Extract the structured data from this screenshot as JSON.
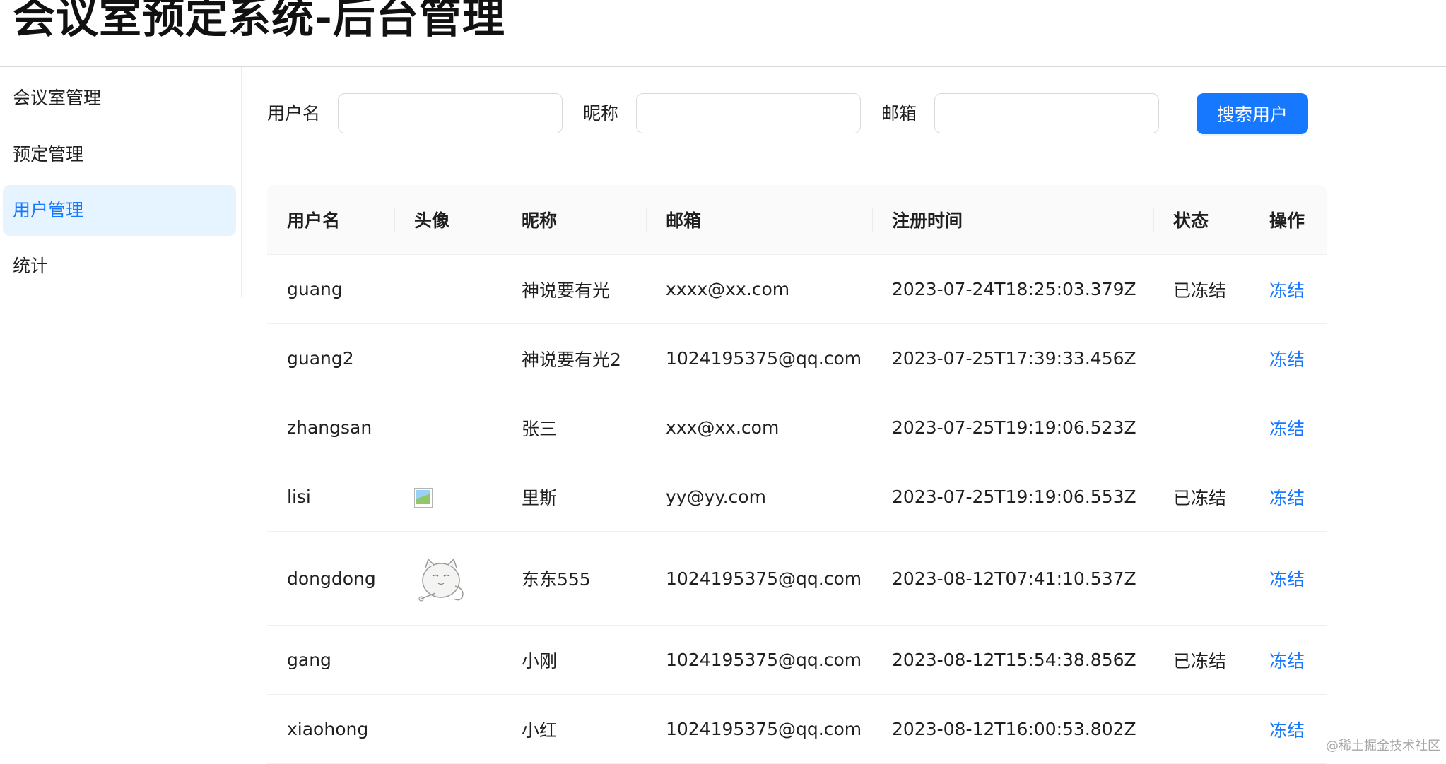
{
  "header": {
    "title": "会议室预定系统-后台管理"
  },
  "sidebar": {
    "items": [
      {
        "label": "会议室管理",
        "active": false
      },
      {
        "label": "预定管理",
        "active": false
      },
      {
        "label": "用户管理",
        "active": true
      },
      {
        "label": "统计",
        "active": false
      }
    ]
  },
  "search": {
    "username_label": "用户名",
    "username_value": "",
    "nickname_label": "昵称",
    "nickname_value": "",
    "email_label": "邮箱",
    "email_value": "",
    "button_label": "搜索用户"
  },
  "table": {
    "columns": [
      "用户名",
      "头像",
      "昵称",
      "邮箱",
      "注册时间",
      "状态",
      "操作"
    ],
    "rows": [
      {
        "username": "guang",
        "avatar": "none",
        "nickname": "神说要有光",
        "email": "xxxx@xx.com",
        "created": "2023-07-24T18:25:03.379Z",
        "status": "已冻结",
        "action": "冻结"
      },
      {
        "username": "guang2",
        "avatar": "none",
        "nickname": "神说要有光2",
        "email": "1024195375@qq.com",
        "created": "2023-07-25T17:39:33.456Z",
        "status": "",
        "action": "冻结"
      },
      {
        "username": "zhangsan",
        "avatar": "none",
        "nickname": "张三",
        "email": "xxx@xx.com",
        "created": "2023-07-25T19:19:06.523Z",
        "status": "",
        "action": "冻结"
      },
      {
        "username": "lisi",
        "avatar": "broken-image-icon",
        "nickname": "里斯",
        "email": "yy@yy.com",
        "created": "2023-07-25T19:19:06.553Z",
        "status": "已冻结",
        "action": "冻结"
      },
      {
        "username": "dongdong",
        "avatar": "cat-sketch-image",
        "nickname": "东东555",
        "email": "1024195375@qq.com",
        "created": "2023-08-12T07:41:10.537Z",
        "status": "",
        "action": "冻结"
      },
      {
        "username": "gang",
        "avatar": "none",
        "nickname": "小刚",
        "email": "1024195375@qq.com",
        "created": "2023-08-12T15:54:38.856Z",
        "status": "已冻结",
        "action": "冻结"
      },
      {
        "username": "xiaohong",
        "avatar": "none",
        "nickname": "小红",
        "email": "1024195375@qq.com",
        "created": "2023-08-12T16:00:53.802Z",
        "status": "",
        "action": "冻结"
      }
    ]
  },
  "watermark": "@稀土掘金技术社区",
  "colors": {
    "primary": "#1677ff",
    "menu_active_bg": "#e6f4ff",
    "header_bg": "#fafafa"
  }
}
